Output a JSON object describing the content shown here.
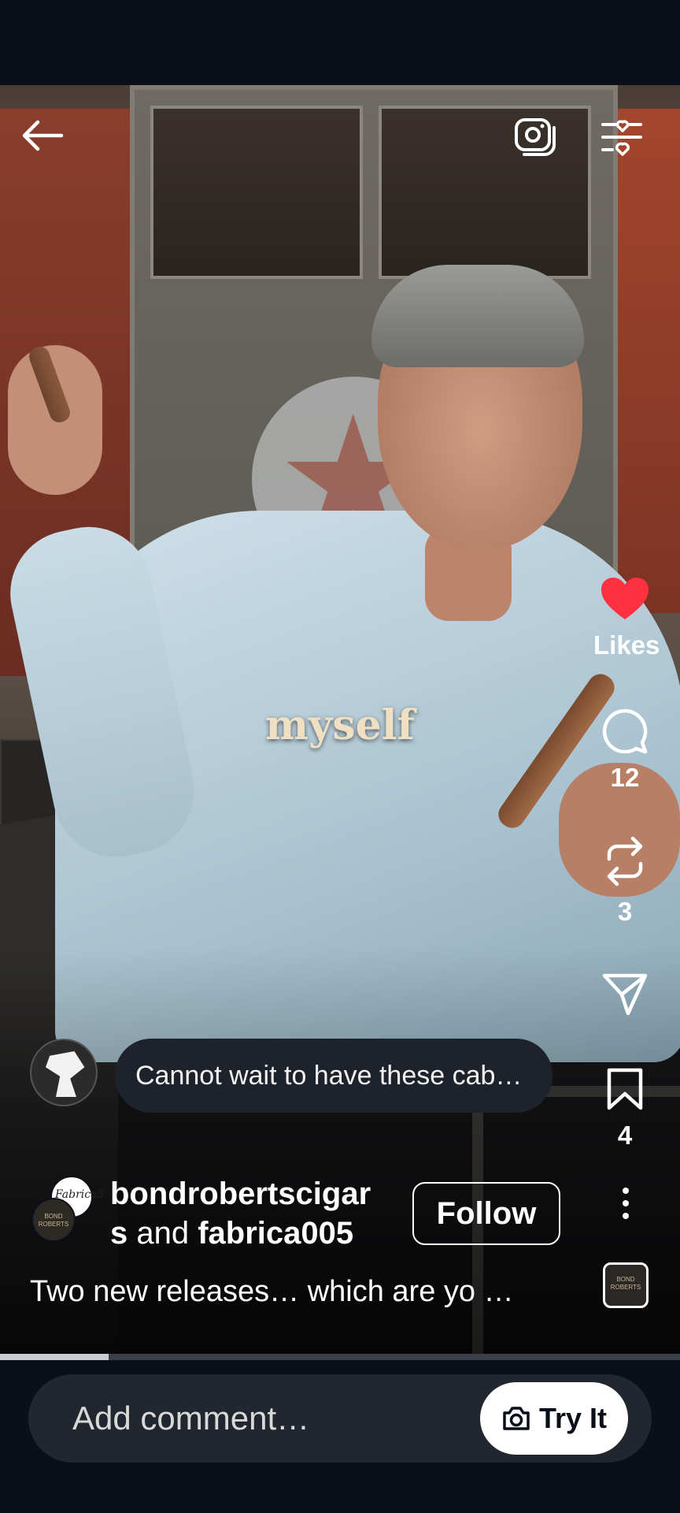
{
  "actions": {
    "likes_label": "Likes",
    "comments_count": "12",
    "reposts_count": "3",
    "saves_count": "4"
  },
  "video": {
    "caption_overlay": "myself",
    "progress_fraction": 0.16
  },
  "note": {
    "text": "Cannot wait to have these cab…"
  },
  "author": {
    "name_part1": "bondrobertscigar",
    "name_part2": "s",
    "joiner": " and ",
    "collaborator": "fabrica005",
    "front_avatar_text": "Fabrica5",
    "back_avatar_text": "BOND ROBERTS",
    "follow_label": "Follow"
  },
  "post": {
    "caption": "Two new releases… which are yo …"
  },
  "audio": {
    "thumb_text": "BOND ROBERTS"
  },
  "comment": {
    "placeholder": "Add comment…",
    "try_label": "Try It"
  },
  "colors": {
    "heart": "#ff3040",
    "background": "#0a0f1a",
    "input_bg": "#22262f"
  },
  "icons": [
    "back-arrow-icon",
    "camera-icon",
    "filter-hearts-icon",
    "heart-icon",
    "comment-icon",
    "repost-icon",
    "share-icon",
    "bookmark-icon",
    "more-icon",
    "camera-small-icon"
  ]
}
